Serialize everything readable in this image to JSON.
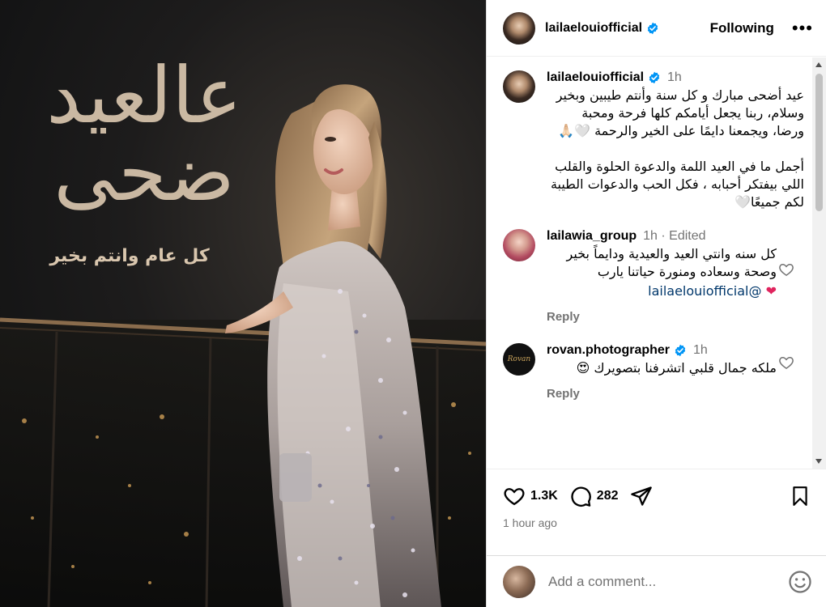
{
  "photo": {
    "calligraphy": "عالعيد ضحى",
    "subtitle": "كل عام وانتم بخير"
  },
  "header": {
    "username": "lailaelouiofficial",
    "following_label": "Following",
    "more_label": "•••"
  },
  "caption": {
    "username": "lailaelouiofficial",
    "time": "1h",
    "paragraph1": "عيد أضحى مبارك و كل سنة وأنتم طيبين وبخير وسلام، ربنا يجعل أيامكم كلها فرحة ومحبة ورضا، ويجمعنا دايمًا على الخير والرحمة 🤍🙏🏻",
    "paragraph2": "أجمل ما في العيد اللمة والدعوة الحلوة والقلب اللي بيفتكر أحبابه ، فكل الحب والدعوات الطيبة لكم جميعًا🤍"
  },
  "comments": [
    {
      "username": "lailawia_group",
      "meta": "1h · Edited",
      "text": "كل سنه وانتي العيد والعيدية ودايماً بخير وصحة وسعاده ومنورة حياتنا يارب",
      "mention": "@lailaelouiofficial",
      "emoji": "❤",
      "reply_label": "Reply"
    },
    {
      "username": "rovan.photographer",
      "meta": "1h",
      "text": "ملكه جمال قلبي اتشرفنا بتصويرك 😍",
      "reply_label": "Reply",
      "avatar_text": "Rovan"
    }
  ],
  "actions": {
    "likes": "1.3K",
    "comments": "282",
    "posted": "1 hour ago"
  },
  "add_comment": {
    "placeholder": "Add a comment..."
  },
  "colors": {
    "verified": "#0095f6",
    "secondary_text": "#737373",
    "mention": "#00376b",
    "photo_text": "#d9c6ae"
  }
}
